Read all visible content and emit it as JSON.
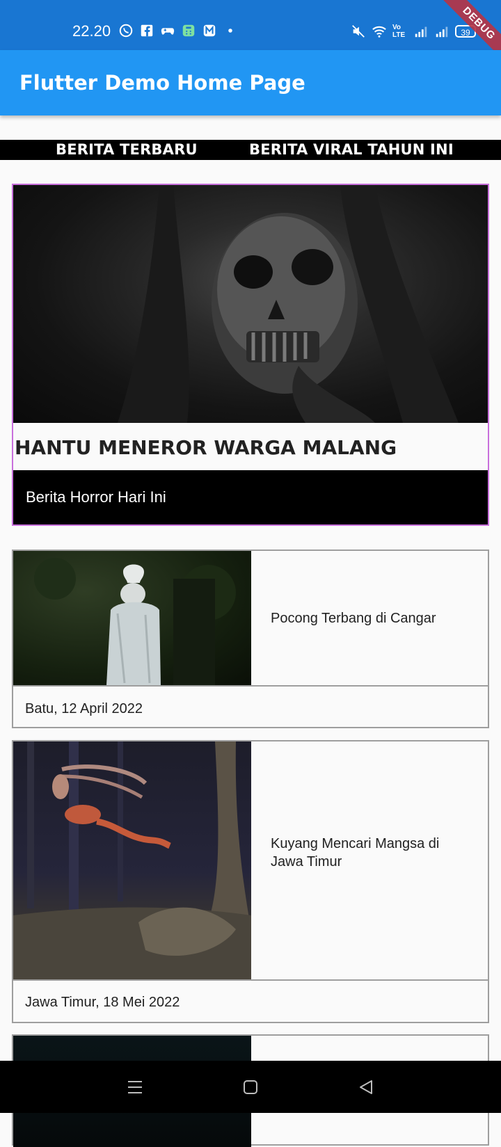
{
  "status_bar": {
    "time": "22.20",
    "battery": "39",
    "network_label": "Vo LTE",
    "left_icons": [
      "whatsapp-icon",
      "facebook-icon",
      "gamepad-icon",
      "calculator-icon",
      "app-icon",
      "dot-icon"
    ],
    "right_icons": [
      "mute-icon",
      "wifi-icon",
      "volte-icon",
      "signal-icon",
      "signal-icon",
      "battery-icon"
    ]
  },
  "debug_banner": "DEBUG",
  "app_bar": {
    "title": "Flutter Demo Home Page"
  },
  "tabs": [
    {
      "label": "BERITA TERBARU"
    },
    {
      "label": "BERITA VIRAL TAHUN INI"
    }
  ],
  "headline": {
    "title": "HANTU MENEROR WARGA MALANG",
    "subtitle": "Berita Horror Hari Ini",
    "border_color": "#c86fdc"
  },
  "news": [
    {
      "title": "Pocong Terbang di Cangar",
      "date": "Batu, 12 April 2022"
    },
    {
      "title": "Kuyang Mencari Mangsa di Jawa Timur",
      "date": "Jawa Timur, 18 Mei 2022"
    },
    {
      "title": "",
      "date": ""
    }
  ],
  "nav_bar": {
    "icons": [
      "menu-icon",
      "home-square-icon",
      "back-triangle-icon"
    ]
  },
  "colors": {
    "status_bar": "#1976d2",
    "app_bar": "#2196f3",
    "tab_strip": "#000000",
    "background": "#fafafa"
  }
}
